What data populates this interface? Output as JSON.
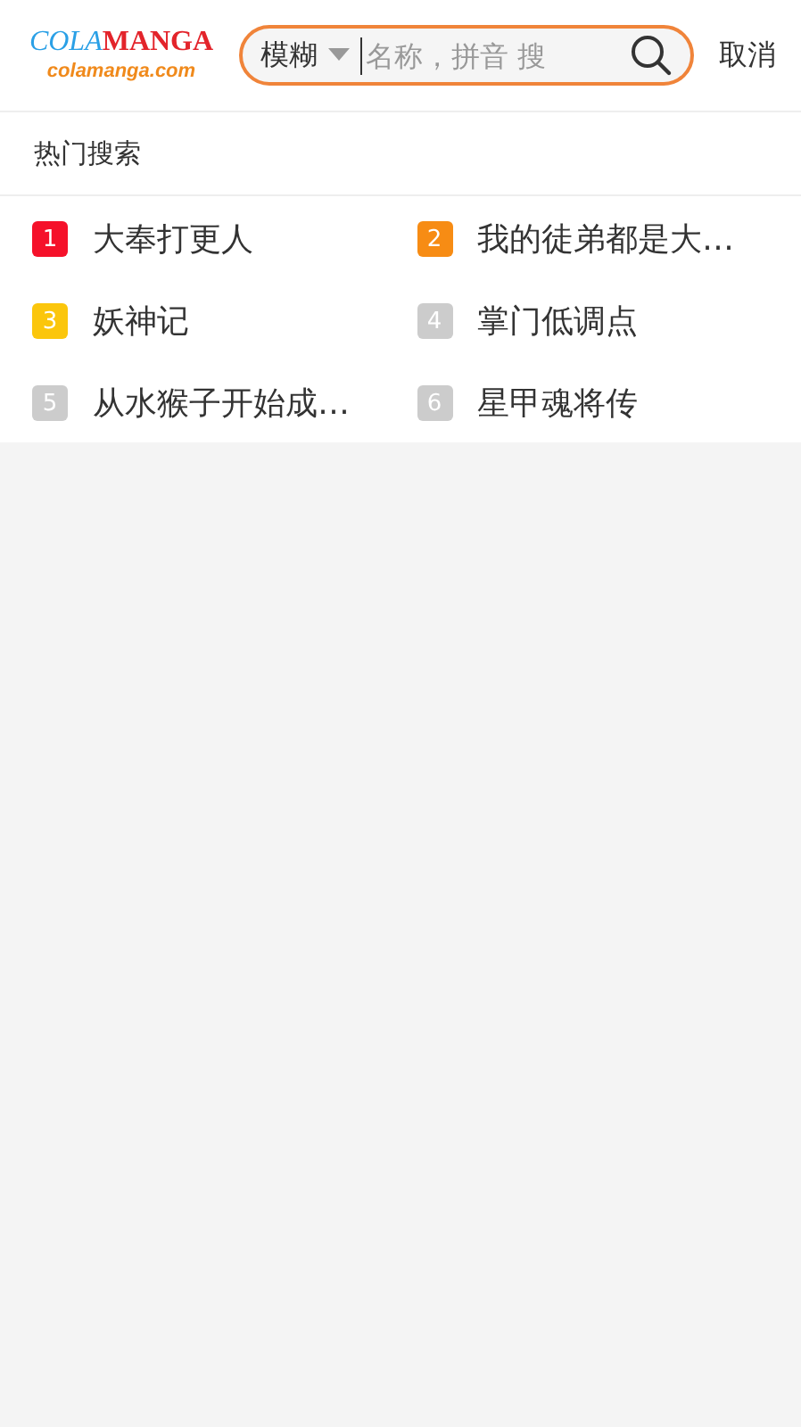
{
  "logo": {
    "part_1": "COLA",
    "part_2": "MANGA",
    "subtitle": "colamanga.com"
  },
  "search": {
    "mode": "模糊",
    "placeholder": "名称，拼音 搜"
  },
  "cancel": "取消",
  "section_title": "热门搜索",
  "hot": [
    {
      "rank": "1",
      "title": "大奉打更人",
      "color": "#f5112a"
    },
    {
      "rank": "2",
      "title": "我的徒弟都是大…",
      "color": "#f78c14"
    },
    {
      "rank": "3",
      "title": "妖神记",
      "color": "#fbc60c"
    },
    {
      "rank": "4",
      "title": "掌门低调点",
      "color": "#cccccc"
    },
    {
      "rank": "5",
      "title": "从水猴子开始成…",
      "color": "#cccccc"
    },
    {
      "rank": "6",
      "title": "星甲魂将传",
      "color": "#cccccc"
    }
  ]
}
